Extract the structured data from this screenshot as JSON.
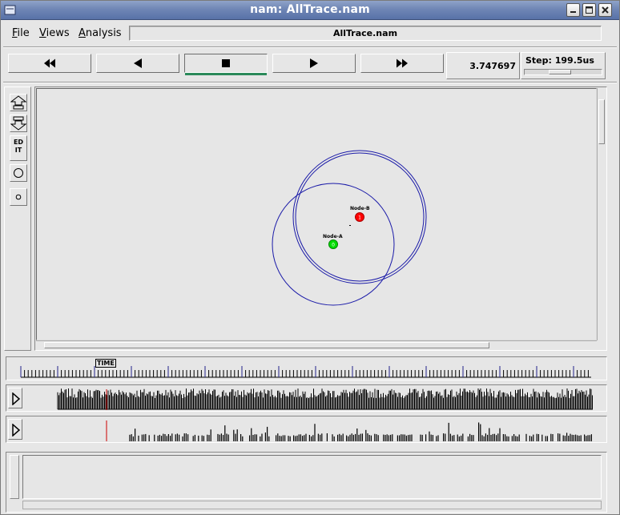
{
  "window": {
    "title": "nam: AllTrace.nam"
  },
  "menu": {
    "items": [
      {
        "key": "F",
        "rest": "ile"
      },
      {
        "key": "V",
        "rest": "iews"
      },
      {
        "key": "A",
        "rest": "nalysis"
      }
    ]
  },
  "trace_file": "AllTrace.nam",
  "playback": {
    "buttons": [
      {
        "icon": "fast-rewind-icon"
      },
      {
        "icon": "play-backward-icon"
      },
      {
        "icon": "stop-icon",
        "active": true
      },
      {
        "icon": "play-forward-icon"
      },
      {
        "icon": "fast-forward-icon"
      }
    ],
    "current_time": "3.747697",
    "step_label": "Step: 199.5us"
  },
  "tools": [
    {
      "icon": "zoom-in-icon"
    },
    {
      "icon": "zoom-out-icon"
    },
    {
      "label": "ED IT"
    },
    {
      "icon": "large-circle-icon"
    },
    {
      "icon": "small-circle-icon"
    }
  ],
  "nodes": [
    {
      "id": "1",
      "label": "Node-B",
      "color": "#ff0000"
    },
    {
      "id": "0",
      "label": "Node-A",
      "color": "#00dd00"
    }
  ],
  "ruler": {
    "time_label": "TIME"
  },
  "colors": {
    "title_bar": "#6f86b5",
    "range_circle": "#1a1aa8",
    "active_indicator": "#2a8a5a",
    "cursor_line": "#cc0000"
  }
}
